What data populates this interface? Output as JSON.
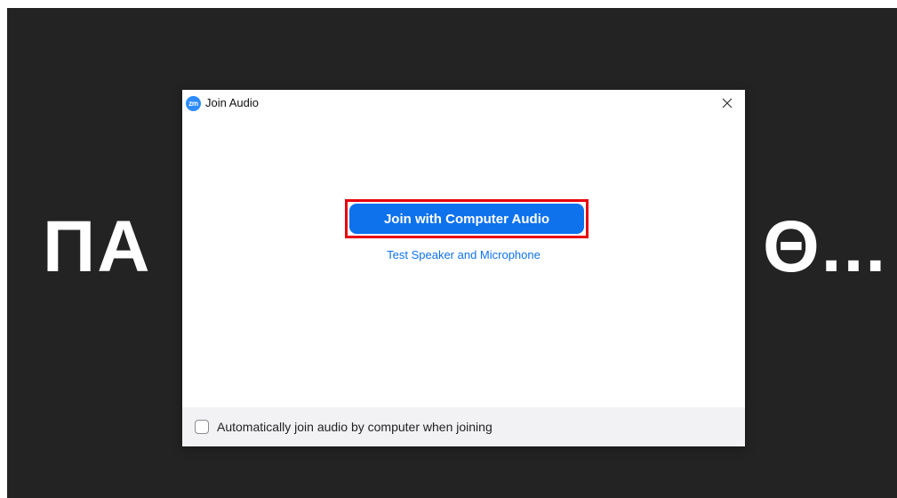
{
  "background": {
    "name_left": "ΠΑ",
    "name_right": "Θ...",
    "color": "#232323"
  },
  "dialog": {
    "app_icon": "zm",
    "title": "Join Audio",
    "close_icon": "close-icon",
    "primary_button": "Join with Computer Audio",
    "link": "Test Speaker and Microphone",
    "footer_checkbox_label": "Automatically join audio by computer when joining",
    "footer_checkbox_checked": false
  },
  "colors": {
    "accent": "#0e72ed",
    "highlight_border": "#e8000b",
    "footer_bg": "#f2f2f5"
  }
}
